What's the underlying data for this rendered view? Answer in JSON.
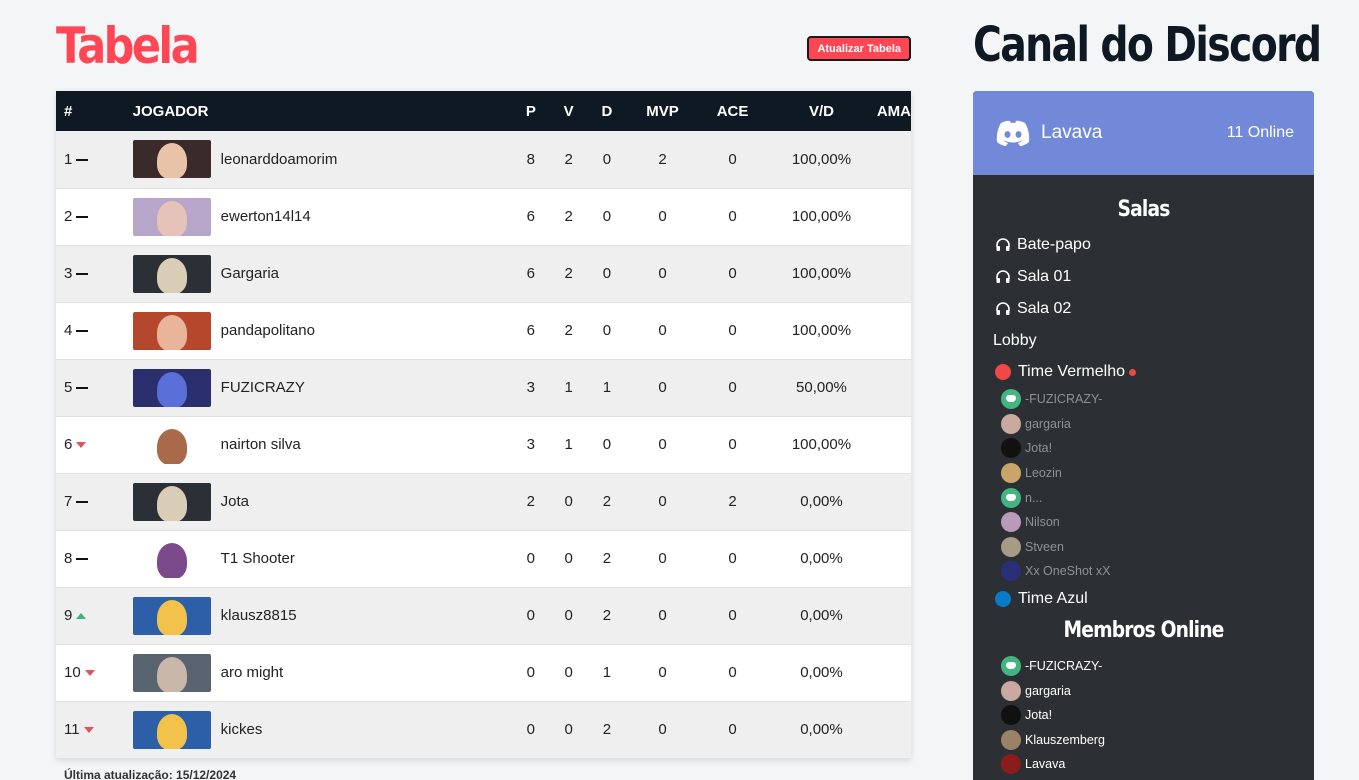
{
  "header": {
    "title": "Tabela",
    "refresh_label": "Atualizar Tabela"
  },
  "table": {
    "columns": [
      "#",
      "JOGADOR",
      "P",
      "V",
      "D",
      "MVP",
      "ACE",
      "V/D",
      "AMA"
    ],
    "rows": [
      {
        "rank": "1",
        "trend": "same",
        "player": "leonarddoamorim",
        "p": "8",
        "v": "2",
        "d": "0",
        "mvp": "2",
        "ace": "0",
        "vd": "100,00%",
        "ama": "",
        "agent_colors": [
          "#3b2a2a",
          "#e9c3a8"
        ]
      },
      {
        "rank": "2",
        "trend": "same",
        "player": "ewerton14l14",
        "p": "6",
        "v": "2",
        "d": "0",
        "mvp": "0",
        "ace": "0",
        "vd": "100,00%",
        "ama": "",
        "agent_colors": [
          "#b7a6c9",
          "#e6c3b8"
        ]
      },
      {
        "rank": "3",
        "trend": "same",
        "player": "Gargaria",
        "p": "6",
        "v": "2",
        "d": "0",
        "mvp": "0",
        "ace": "0",
        "vd": "100,00%",
        "ama": "",
        "agent_colors": [
          "#2a3036",
          "#d9cdb8"
        ]
      },
      {
        "rank": "4",
        "trend": "same",
        "player": "pandapolitano",
        "p": "6",
        "v": "2",
        "d": "0",
        "mvp": "0",
        "ace": "0",
        "vd": "100,00%",
        "ama": "",
        "agent_colors": [
          "#b5472c",
          "#e8b59a"
        ]
      },
      {
        "rank": "5",
        "trend": "same",
        "player": "FUZICRAZY",
        "p": "3",
        "v": "1",
        "d": "1",
        "mvp": "0",
        "ace": "0",
        "vd": "50,00%",
        "ama": "",
        "agent_colors": [
          "#2c2f6e",
          "#5b6fd8"
        ]
      },
      {
        "rank": "6",
        "trend": "down",
        "player": "nairton silva",
        "p": "3",
        "v": "1",
        "d": "0",
        "mvp": "0",
        "ace": "0",
        "vd": "100,00%",
        "ama": "",
        "agent_colors": [
          "#ffffff",
          "#a86a4a"
        ]
      },
      {
        "rank": "7",
        "trend": "same",
        "player": "Jota",
        "p": "2",
        "v": "0",
        "d": "2",
        "mvp": "0",
        "ace": "2",
        "vd": "0,00%",
        "ama": "",
        "agent_colors": [
          "#2a3036",
          "#d9cdb8"
        ]
      },
      {
        "rank": "8",
        "trend": "same",
        "player": "T1 Shooter",
        "p": "0",
        "v": "0",
        "d": "2",
        "mvp": "0",
        "ace": "0",
        "vd": "0,00%",
        "ama": "",
        "agent_colors": [
          "#ffffff",
          "#7a4a8c"
        ]
      },
      {
        "rank": "9",
        "trend": "up",
        "player": "klausz8815",
        "p": "0",
        "v": "0",
        "d": "2",
        "mvp": "0",
        "ace": "0",
        "vd": "0,00%",
        "ama": "",
        "agent_colors": [
          "#2d5fa8",
          "#f2c24a"
        ]
      },
      {
        "rank": "10",
        "trend": "down",
        "player": "aro might",
        "p": "0",
        "v": "0",
        "d": "1",
        "mvp": "0",
        "ace": "0",
        "vd": "0,00%",
        "ama": "",
        "agent_colors": [
          "#5a6470",
          "#c9b7a9"
        ]
      },
      {
        "rank": "11",
        "trend": "down",
        "player": "kickes",
        "p": "0",
        "v": "0",
        "d": "2",
        "mvp": "0",
        "ace": "0",
        "vd": "0,00%",
        "ama": "",
        "agent_colors": [
          "#2d5fa8",
          "#f2c24a"
        ]
      }
    ]
  },
  "footer": {
    "updated": "Última atualização: 15/12/2024"
  },
  "discord": {
    "title": "Canal do Discord",
    "server": "Lavava",
    "online": "11 Online",
    "rooms_title": "Salas",
    "rooms": [
      "Bate-papo",
      "Sala 01",
      "Sala 02"
    ],
    "lobby": "Lobby",
    "team_red": {
      "name": "Time Vermelho",
      "color": "#f04747"
    },
    "team_red_members": [
      {
        "name": "-FUZICRAZY-",
        "avatar": "discord"
      },
      {
        "name": "gargaria",
        "avatar": "#c9a9a0"
      },
      {
        "name": "Jota!",
        "avatar": "#111111"
      },
      {
        "name": "Leozin",
        "avatar": "#caa56b"
      },
      {
        "name": "n...",
        "avatar": "discord"
      },
      {
        "name": "Nilson",
        "avatar": "#b99ab8"
      },
      {
        "name": "Stveen",
        "avatar": "#a59b86"
      },
      {
        "name": "Xx OneShot xX",
        "avatar": "#2a2f7a"
      }
    ],
    "team_blue": {
      "name": "Time Azul",
      "color": "#0a7bc7"
    },
    "members_title": "Membros Online",
    "members_online": [
      {
        "name": "-FUZICRAZY-",
        "avatar": "discord"
      },
      {
        "name": "gargaria",
        "avatar": "#c9a9a0"
      },
      {
        "name": "Jota!",
        "avatar": "#111111"
      },
      {
        "name": "Klauszemberg",
        "avatar": "#9a8266"
      },
      {
        "name": "Lavava",
        "avatar": "#8a1c1c"
      }
    ]
  },
  "colors": {
    "accent": "#ff4655",
    "dark": "#0f1923",
    "discord": "#7289da"
  }
}
